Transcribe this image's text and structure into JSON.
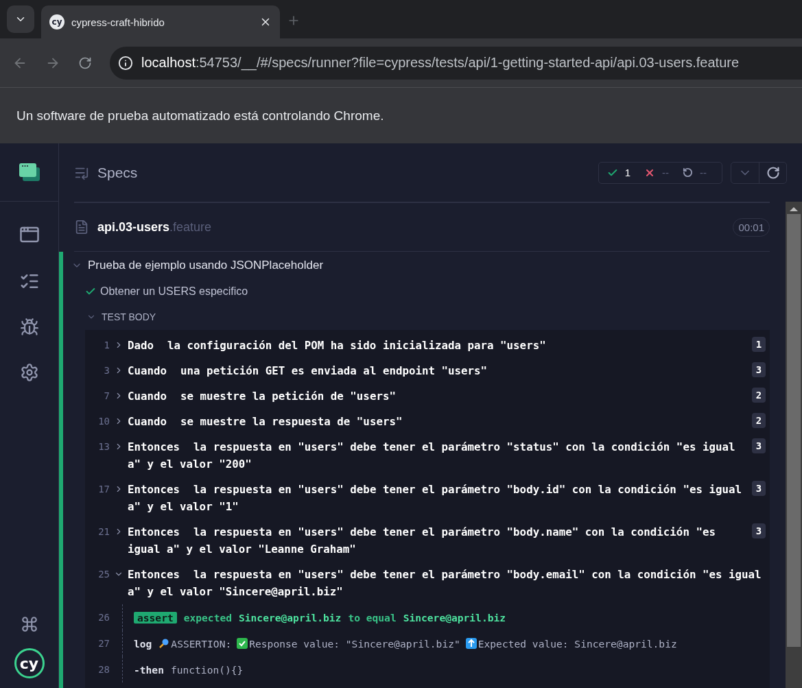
{
  "browser": {
    "tab": {
      "favicon": "cy",
      "title": "cypress-craft-hibrido",
      "selected": true
    },
    "address": {
      "host": "localhost",
      "rest": ":54753/__/#/specs/runner?file=cypress/tests/api/1-getting-started-api/api.03-users.feature"
    },
    "infobar": "Un software de prueba automatizado está controlando Chrome."
  },
  "sidebar": {
    "logo": "cy"
  },
  "header": {
    "title": "Specs",
    "stats": [
      {
        "kind": "passed",
        "value": "1"
      },
      {
        "kind": "failed",
        "value": "--"
      },
      {
        "kind": "pending",
        "value": "--"
      }
    ]
  },
  "spec": {
    "name": "api.03-users",
    "extension": ".feature",
    "duration": "00:01"
  },
  "suite": {
    "title": "Prueba de ejemplo usando JSONPlaceholder",
    "expanded": true
  },
  "test": {
    "title": "Obtener un USERS especifico",
    "passed": true
  },
  "body": {
    "label": "TEST BODY",
    "expanded": true
  },
  "steps": [
    {
      "num": "1",
      "keyword": "Dado",
      "text": "la configuración del POM ha sido inicializada para \"users\"",
      "count": "1",
      "expanded": false
    },
    {
      "num": "3",
      "keyword": "Cuando",
      "text": "una petición GET es enviada al endpoint \"users\"",
      "count": "3",
      "expanded": false
    },
    {
      "num": "7",
      "keyword": "Cuando",
      "text": "se muestre la petición de \"users\"",
      "count": "2",
      "expanded": false
    },
    {
      "num": "10",
      "keyword": "Cuando",
      "text": "se muestre la respuesta de \"users\"",
      "count": "2",
      "expanded": false
    },
    {
      "num": "13",
      "keyword": "Entonces",
      "text": "la respuesta en \"users\" debe tener el parámetro \"status\" con la condición \"es igual a\" y el valor \"200\"",
      "count": "3",
      "expanded": false
    },
    {
      "num": "17",
      "keyword": "Entonces",
      "text": "la respuesta en \"users\" debe tener el parámetro \"body.id\" con la condición \"es igual a\" y el valor \"1\"",
      "count": "3",
      "expanded": false
    },
    {
      "num": "21",
      "keyword": "Entonces",
      "text": "la respuesta en \"users\" debe tener el parámetro \"body.name\" con la condición \"es igual a\" y el valor \"Leanne Graham\"",
      "count": "3",
      "expanded": false
    },
    {
      "num": "25",
      "keyword": "Entonces",
      "text": "la respuesta en \"users\" debe tener el parámetro \"body.email\" con la condición \"es igual a\" y el valor \"Sincere@april.biz\"",
      "expanded": true,
      "commands": [
        {
          "num": "26",
          "kind": "assert",
          "name": "assert",
          "parts": [
            {
              "text": "expected",
              "strong": false
            },
            {
              "text": "Sincere@april.biz",
              "strong": true
            },
            {
              "text": "to equal",
              "strong": false
            },
            {
              "text": "Sincere@april.biz",
              "strong": true
            }
          ]
        },
        {
          "num": "27",
          "kind": "log",
          "name": "log",
          "segments": [
            {
              "kind": "search",
              "text": "ASSERTION:"
            },
            {
              "kind": "check",
              "text": "Response value: \"Sincere@april.biz\""
            },
            {
              "kind": "up",
              "text": "Expected value: Sincere@april.biz"
            }
          ]
        },
        {
          "num": "28",
          "kind": "then",
          "name": "-then",
          "message": "function(){}"
        }
      ]
    }
  ]
}
